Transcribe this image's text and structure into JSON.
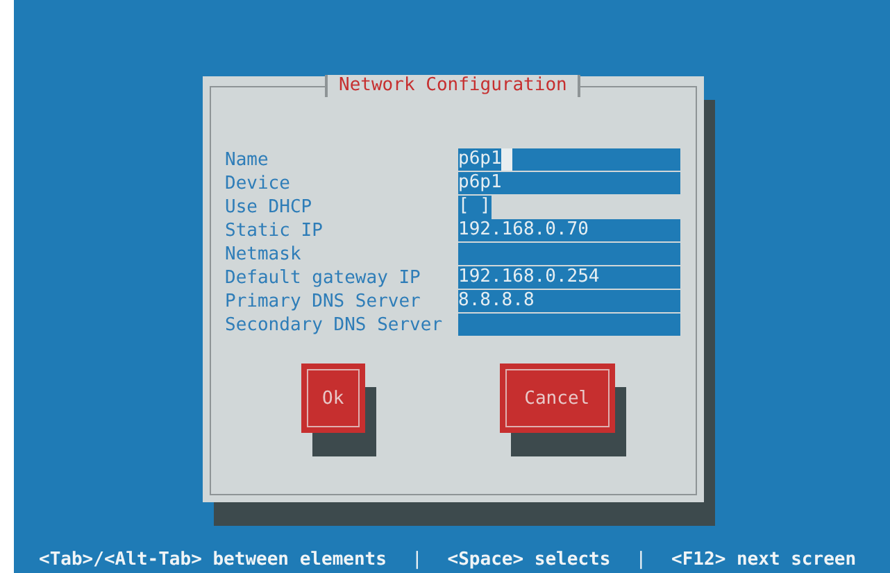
{
  "dialog": {
    "title": "Network Configuration",
    "fields": [
      {
        "label": "Name",
        "kind": "text",
        "value": "p6p1",
        "focused": true
      },
      {
        "label": "Device",
        "kind": "text",
        "value": "p6p1",
        "focused": false
      },
      {
        "label": "Use DHCP",
        "kind": "checkbox",
        "value": "[ ]",
        "checked": false
      },
      {
        "label": "Static IP",
        "kind": "text",
        "value": "192.168.0.70",
        "focused": false
      },
      {
        "label": "Netmask",
        "kind": "text",
        "focused": false
      },
      {
        "label": "Default gateway IP",
        "kind": "text",
        "value": "192.168.0.254",
        "focused": false
      },
      {
        "label": "Primary DNS Server",
        "kind": "text",
        "value": "8.8.8.8",
        "focused": false
      },
      {
        "label": "Secondary DNS Server",
        "kind": "text",
        "focused": false
      }
    ],
    "buttons": [
      {
        "label": "Ok"
      },
      {
        "label": "Cancel"
      }
    ]
  },
  "status_bar": [
    {
      "kind": "hint",
      "text": "<Tab>/<Alt-Tab> between elements"
    },
    {
      "kind": "separator",
      "text": "|"
    },
    {
      "kind": "hint",
      "text": "<Space> selects"
    },
    {
      "kind": "separator",
      "text": "|"
    },
    {
      "kind": "hint",
      "text": "<F12> next screen"
    }
  ]
}
